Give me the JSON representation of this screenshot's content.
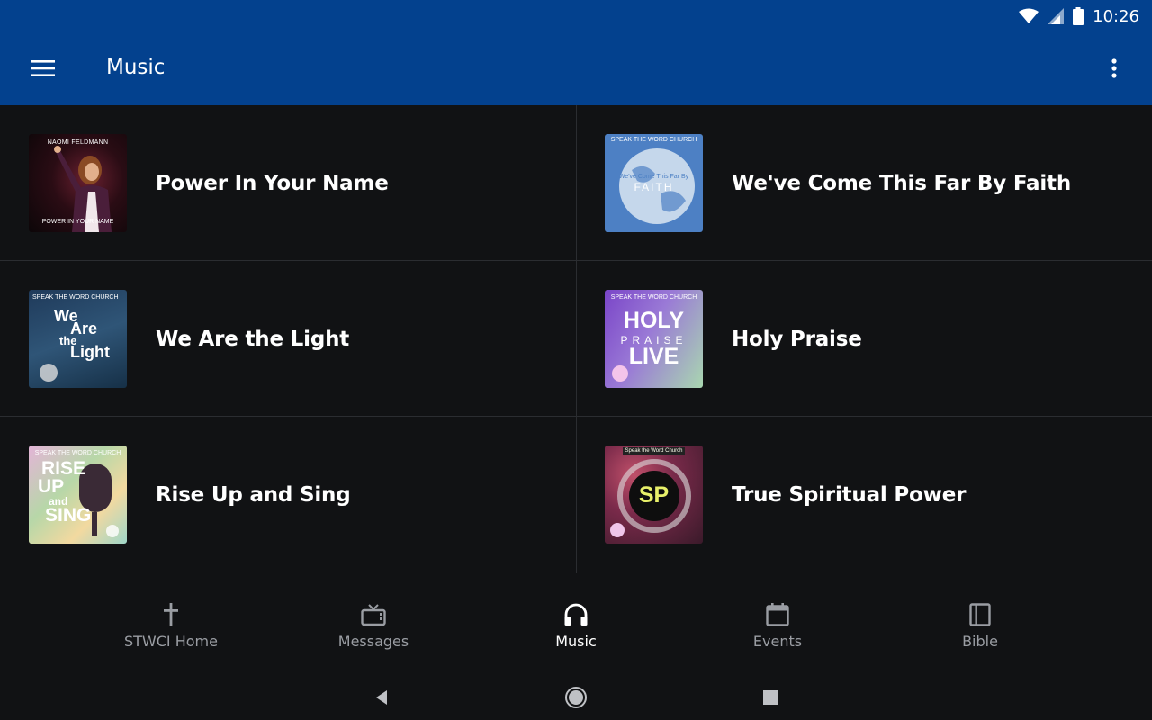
{
  "status_bar": {
    "time": "10:26"
  },
  "app_bar": {
    "title": "Music"
  },
  "albums": [
    {
      "title": "Power In Your Name",
      "art_top": "NAOMI FELDMANN",
      "art_bottom": "POWER IN YOUR NAME"
    },
    {
      "title": "We've Come This Far By Faith",
      "art_top": "SPEAK THE WORD CHURCH",
      "art_line1": "We've Come This Far By",
      "art_line2": "FAITH"
    },
    {
      "title": "We Are the Light",
      "art_top": "SPEAK THE WORD CHURCH",
      "art_line1": "We",
      "art_line2": "Are",
      "art_line3": "the",
      "art_line4": "Light"
    },
    {
      "title": "Holy Praise",
      "art_top": "SPEAK THE WORD CHURCH",
      "art_line1": "HOLY",
      "art_line2": "PRAISE",
      "art_line3": "LIVE"
    },
    {
      "title": "Rise Up and Sing",
      "art_top": "SPEAK THE WORD CHURCH",
      "art_line1": "RISE",
      "art_line2": "UP",
      "art_line3": "and",
      "art_line4": "SING"
    },
    {
      "title": "True Spiritual Power",
      "art_top": "Speak the Word Church",
      "art_line1": "SP"
    }
  ],
  "bottom_nav": [
    {
      "label": "STWCI Home",
      "icon": "cross-icon"
    },
    {
      "label": "Messages",
      "icon": "tv-icon"
    },
    {
      "label": "Music",
      "icon": "headphones-icon",
      "active": true
    },
    {
      "label": "Events",
      "icon": "calendar-icon"
    },
    {
      "label": "Bible",
      "icon": "book-icon"
    }
  ],
  "colors": {
    "app_bar": "#03418e",
    "background": "#111214",
    "divider": "#2b2d31",
    "nav_inactive": "#9a9da3"
  }
}
